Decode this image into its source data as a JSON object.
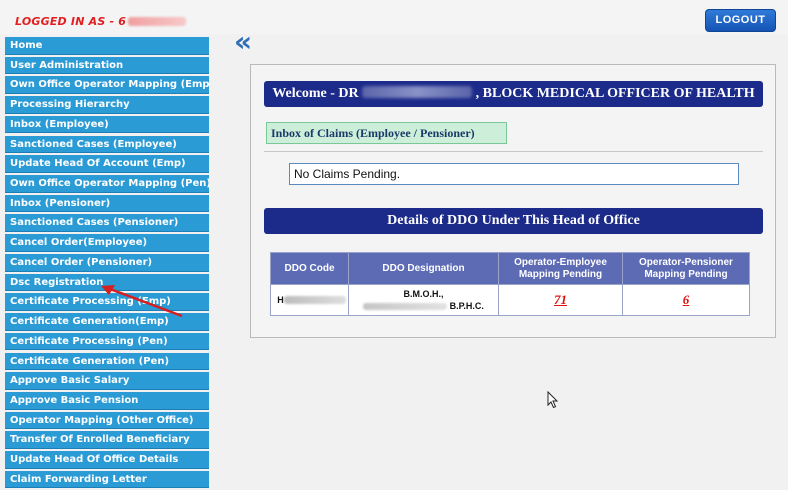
{
  "header": {
    "logged_in_prefix": "LOGGED IN AS - 6",
    "logout_label": "LOGOUT"
  },
  "sidebar": {
    "items": [
      {
        "label": "Home"
      },
      {
        "label": "User Administration"
      },
      {
        "label": "Own Office Operator Mapping (Emp)"
      },
      {
        "label": "Processing Hierarchy"
      },
      {
        "label": "Inbox (Employee)"
      },
      {
        "label": "Sanctioned Cases (Employee)"
      },
      {
        "label": "Update Head Of Account (Emp)"
      },
      {
        "label": "Own Office Operator Mapping (Pen)"
      },
      {
        "label": "Inbox (Pensioner)"
      },
      {
        "label": "Sanctioned Cases (Pensioner)"
      },
      {
        "label": "Cancel Order(Employee)"
      },
      {
        "label": "Cancel Order (Pensioner)"
      },
      {
        "label": "Dsc Registration"
      },
      {
        "label": "Certificate Processing (Emp)"
      },
      {
        "label": "Certificate Generation(Emp)"
      },
      {
        "label": "Certificate Processing (Pen)"
      },
      {
        "label": "Certificate Generation (Pen)"
      },
      {
        "label": "Approve Basic Salary"
      },
      {
        "label": "Approve Basic Pension"
      },
      {
        "label": "Operator Mapping (Other Office)"
      },
      {
        "label": "Transfer Of Enrolled Beneficiary"
      },
      {
        "label": "Update Head Of Office Details"
      },
      {
        "label": "Claim Forwarding Letter"
      }
    ]
  },
  "main": {
    "back_icon": "double-chevron-left-icon",
    "welcome_prefix": "Welcome - DR",
    "welcome_suffix": ", BLOCK MEDICAL OFFICER OF HEALTH",
    "inbox_label": "Inbox of Claims (Employee / Pensioner)",
    "no_claims_text": "No Claims Pending.",
    "ddo_title": "Details of DDO Under This Head of Office",
    "table": {
      "headers": [
        "DDO Code",
        "DDO Designation",
        "Operator-Employee Mapping Pending",
        "Operator-Pensioner Mapping Pending"
      ],
      "rows": [
        {
          "code_prefix": "H",
          "designation_line1": "B.M.O.H.,",
          "designation_line2": "B.P.H.C.",
          "emp_pending": "71",
          "pen_pending": "6"
        }
      ]
    }
  },
  "colors": {
    "sidebar_item": "#2b9bd6",
    "banner": "#1c2a8a",
    "table_header": "#5d6bb5",
    "annotation_arrow": "#d42020",
    "link_red": "#e01010"
  }
}
